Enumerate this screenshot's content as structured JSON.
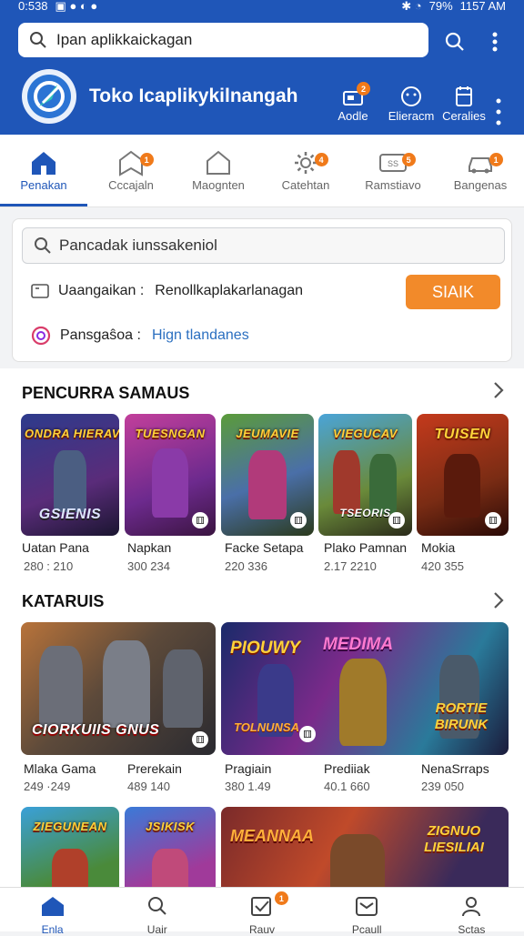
{
  "status": {
    "time_left": "0:538",
    "battery": "79%",
    "time_right": "1157 AM"
  },
  "search": {
    "placeholder": "Ipan aplikkaickagan"
  },
  "brand": {
    "name": "Toko Icaplikykilnangah"
  },
  "header_actions": [
    {
      "label": "Aodle",
      "icon": "store-icon",
      "badge": "2"
    },
    {
      "label": "Elieracm",
      "icon": "smiley-icon",
      "badge": ""
    },
    {
      "label": "Ceralies",
      "icon": "calendar-icon",
      "badge": ""
    }
  ],
  "categories": [
    {
      "label": "Penakan",
      "icon": "home-icon",
      "badge": "",
      "active": true
    },
    {
      "label": "Cccajaln",
      "icon": "bookmark-icon",
      "badge": "1"
    },
    {
      "label": "Maognten",
      "icon": "house-outline-icon",
      "badge": ""
    },
    {
      "label": "Catehtan",
      "icon": "gear-icon",
      "badge": "4"
    },
    {
      "label": "Ramstiavo",
      "icon": "ticket-icon",
      "badge": "5"
    },
    {
      "label": "Bangenas",
      "icon": "car-icon",
      "badge": "1"
    }
  ],
  "panel": {
    "search_placeholder": "Pancadak iunssakeniol",
    "row1_key": "Uaangaikan :",
    "row1_value": "Renollkaplakarlanagan",
    "row2_key": "Pansgaŝoa :",
    "row2_value": "Hign tlandanes",
    "action": "SIAIK"
  },
  "section1": {
    "title": "PENCURRA SAMAUS",
    "games": [
      {
        "caption_top": "ONDRA HIERAVIAN",
        "caption_bottom": "GSIENIS",
        "name": "Uatan Pana",
        "value": "280 : 210"
      },
      {
        "caption_top": "TUESNGAN",
        "caption_bottom": "",
        "name": "Napkan",
        "value": "300 234"
      },
      {
        "caption_top": "JEUMAVIE",
        "caption_bottom": "",
        "name": "Facke Setapa",
        "value": "220 336"
      },
      {
        "caption_top": "VIEGUCAV",
        "caption_bottom": "TSEORIS",
        "name": "Plako Pamnan",
        "value": "2.17 2210"
      },
      {
        "caption_top": "TUISEN",
        "caption_bottom": "",
        "name": "Mokia",
        "value": "420 355"
      }
    ]
  },
  "section2": {
    "title": "KATARUIS",
    "banners": [
      {
        "caption": "CIORKUIIS GNUS"
      },
      {
        "caption_left": "PIOUWY",
        "caption_mid": "MEDIMA",
        "caption_low": "TOLNUNSA",
        "caption_right": "RORTIE BIRUNK"
      }
    ],
    "games": [
      {
        "name": "Mlaka Gama",
        "value": "249 ·249"
      },
      {
        "name": "Prerekain",
        "value": "489 140"
      },
      {
        "name": "Pragiain",
        "value": "380 1.49"
      },
      {
        "name": "Prediiak",
        "value": "40.1 660"
      },
      {
        "name": "NenaSrraps",
        "value": "239 050"
      }
    ]
  },
  "section3": {
    "captions": [
      "ZIEGUNEAN",
      "JSIKISK",
      "MEANNAA",
      "ZIGNUO LIESILIAI"
    ]
  },
  "bottom_nav": [
    {
      "label": "Enla",
      "icon": "home-icon",
      "active": true,
      "badge": ""
    },
    {
      "label": "Uair",
      "icon": "search-icon",
      "badge": ""
    },
    {
      "label": "Rauv",
      "icon": "checkbox-icon",
      "badge": "1"
    },
    {
      "label": "Pcaull",
      "icon": "box-icon",
      "badge": ""
    },
    {
      "label": "Sctas",
      "icon": "person-icon",
      "badge": ""
    }
  ],
  "colors": {
    "brand_blue": "#1f56b8",
    "accent_orange": "#f28a2a",
    "link_blue": "#2b6fc0"
  }
}
